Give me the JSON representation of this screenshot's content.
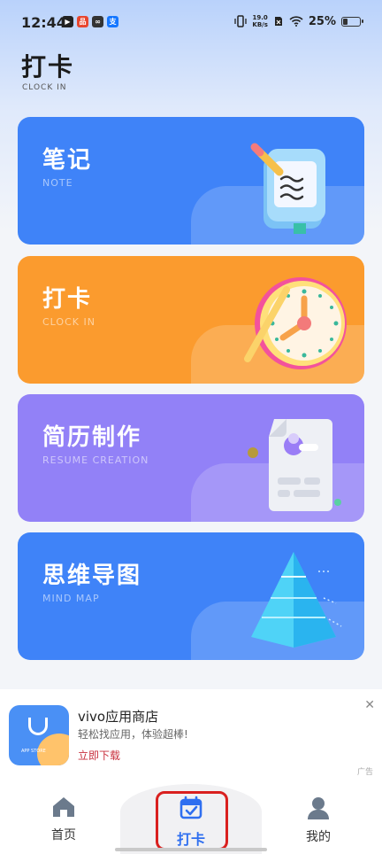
{
  "status_bar": {
    "time": "12:44",
    "net_speed_value": "19.0",
    "net_speed_unit": "KB/s",
    "battery": "25%"
  },
  "header": {
    "title": "打卡",
    "subtitle": "CLOCK IN"
  },
  "cards": [
    {
      "title": "笔记",
      "subtitle": "NOTE",
      "icon": "notebook-icon",
      "color": "#3f83f8"
    },
    {
      "title": "打卡",
      "subtitle": "CLOCK IN",
      "icon": "clock-icon",
      "color": "#fb9b2e"
    },
    {
      "title": "简历制作",
      "subtitle": "RESUME CREATION",
      "icon": "resume-icon",
      "color": "#9281f7"
    },
    {
      "title": "思维导图",
      "subtitle": "MIND MAP",
      "icon": "pyramid-icon",
      "color": "#3f83f8"
    }
  ],
  "ad": {
    "app_name": "vivo应用商店",
    "description": "轻松找应用，体验超棒!",
    "cta": "立即下载",
    "icon_text": "APP STORE",
    "label": "广告"
  },
  "bottom_nav": {
    "items": [
      {
        "label": "首页",
        "icon": "home-icon"
      },
      {
        "label": "打卡",
        "icon": "calendar-check-icon",
        "active": true
      },
      {
        "label": "我的",
        "icon": "user-icon"
      }
    ],
    "active_color": "#2f6ff0"
  }
}
